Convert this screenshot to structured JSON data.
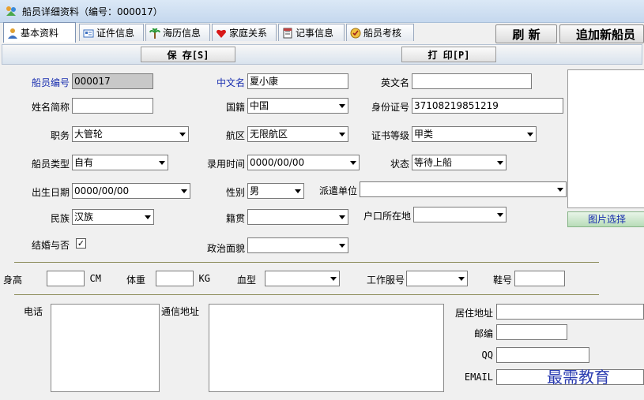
{
  "window": {
    "title": "船员详细资料（编号：000017）",
    "icon": "app-icon"
  },
  "tabs": [
    {
      "label": "基本资料",
      "icon": "person-icon",
      "active": true
    },
    {
      "label": "证件信息",
      "icon": "id-card-icon"
    },
    {
      "label": "海历信息",
      "icon": "palm-tree-icon"
    },
    {
      "label": "家庭关系",
      "icon": "heart-icon"
    },
    {
      "label": "记事信息",
      "icon": "notepad-icon"
    },
    {
      "label": "船员考核",
      "icon": "assessment-icon"
    }
  ],
  "buttons": {
    "refresh": "刷 新",
    "add_new": "追加新船员",
    "save": "保 存[S]",
    "print": "打 印[P]",
    "photo_select": "图片选择"
  },
  "form": {
    "crew_no": {
      "label": "船员编号",
      "value": "000017"
    },
    "cn_name": {
      "label": "中文名",
      "value": "夏小康"
    },
    "en_name": {
      "label": "英文名",
      "value": ""
    },
    "short_name": {
      "label": "姓名简称",
      "value": ""
    },
    "nationality": {
      "label": "国籍",
      "value": "中国"
    },
    "id_no": {
      "label": "身份证号",
      "value": "37108219851219"
    },
    "duty": {
      "label": "职务",
      "value": "大管轮"
    },
    "nav_area": {
      "label": "航区",
      "value": "无限航区"
    },
    "cert_grade": {
      "label": "证书等级",
      "value": "甲类"
    },
    "crew_type": {
      "label": "船员类型",
      "value": "自有"
    },
    "hire_date": {
      "label": "录用时间",
      "value": "0000/00/00"
    },
    "status": {
      "label": "状态",
      "value": "等待上船"
    },
    "birth_date": {
      "label": "出生日期",
      "value": "0000/00/00"
    },
    "gender": {
      "label": "性别",
      "value": "男"
    },
    "dispatch_unit": {
      "label": "派遣单位",
      "value": ""
    },
    "ethnicity": {
      "label": "民族",
      "value": "汉族"
    },
    "native_place": {
      "label": "籍贯",
      "value": ""
    },
    "household": {
      "label": "户口所在地",
      "value": ""
    },
    "married": {
      "label": "结婚与否",
      "checked": true,
      "mark": "✓"
    },
    "politics": {
      "label": "政治面貌",
      "value": ""
    }
  },
  "body": {
    "height": {
      "label": "身高",
      "value": "",
      "unit": "CM"
    },
    "weight": {
      "label": "体重",
      "value": "",
      "unit": "KG"
    },
    "blood": {
      "label": "血型",
      "value": ""
    },
    "uniform": {
      "label": "工作服号",
      "value": ""
    },
    "shoe": {
      "label": "鞋号",
      "value": ""
    }
  },
  "contact": {
    "phone": {
      "label": "电话",
      "value": ""
    },
    "mail_addr": {
      "label": "通信地址",
      "value": ""
    },
    "home_addr": {
      "label": "居住地址",
      "value": ""
    },
    "zip": {
      "label": "邮编",
      "value": ""
    },
    "qq": {
      "label": "QQ",
      "value": ""
    },
    "email": {
      "label": "EMAIL",
      "value": ""
    }
  },
  "watermark": "最需教育"
}
